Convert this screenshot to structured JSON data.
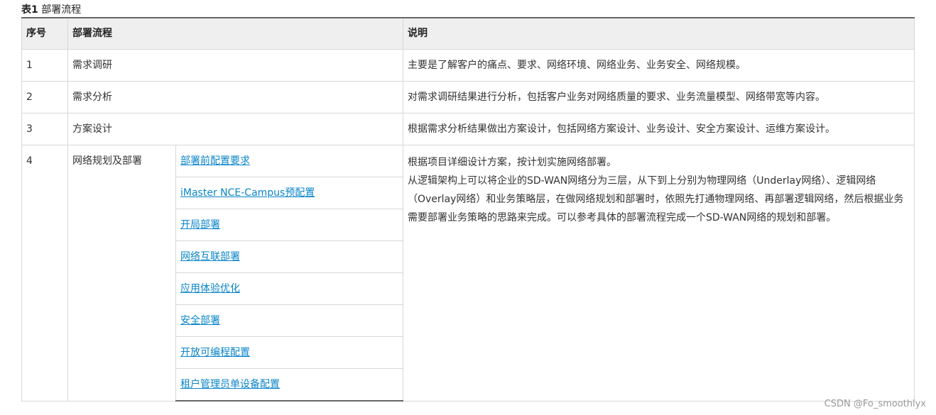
{
  "caption": {
    "label": "表1",
    "title": "部署流程"
  },
  "table": {
    "headers": [
      "序号",
      "部署流程",
      "说明"
    ],
    "rows": [
      {
        "no": "1",
        "step": "需求调研",
        "desc": "主要是了解客户的痛点、要求、网络环境、网络业务、业务安全、网络规模。"
      },
      {
        "no": "2",
        "step": "需求分析",
        "desc": "对需求调研结果进行分析，包括客户业务对网络质量的要求、业务流量模型、网络带宽等内容。"
      },
      {
        "no": "3",
        "step": "方案设计",
        "desc": "根据需求分析结果做出方案设计，包括网络方案设计、业务设计、安全方案设计、运维方案设计。"
      }
    ],
    "row4": {
      "no": "4",
      "step": "网络规划及部署",
      "links": [
        "部署前配置要求",
        "iMaster NCE-Campus预配置",
        "开局部署",
        "网络互联部署",
        "应用体验优化",
        "安全部署",
        "开放可编程配置",
        "租户管理员单设备配置"
      ],
      "desc_line1": "根据项目详细设计方案，按计划实施网络部署。",
      "desc_line2": "从逻辑架构上可以将企业的SD-WAN网络分为三层，从下到上分别为物理网络（Underlay网络）、逻辑网络（Overlay网络）和业务策略层，在做网络规划和部署时，依照先打通物理网络、再部署逻辑网络，然后根据业务需要部署业务策略的思路来完成。可以参考具体的部署流程完成一个SD-WAN网络的规划和部署。"
    }
  },
  "watermark": "CSDN @Fo_smoothlyx"
}
